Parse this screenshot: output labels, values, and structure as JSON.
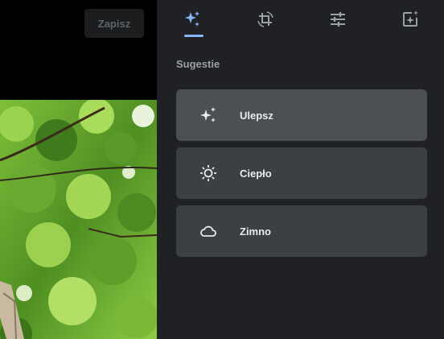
{
  "toolbar": {
    "save_label": "Zapisz"
  },
  "tabs": [
    {
      "name": "suggestions-tab",
      "icon": "sparkle-icon",
      "active": true
    },
    {
      "name": "crop-rotate-tab",
      "icon": "crop-rotate-icon",
      "active": false
    },
    {
      "name": "adjust-tab",
      "icon": "sliders-icon",
      "active": false
    },
    {
      "name": "filters-tab",
      "icon": "image-sparkle-icon",
      "active": false
    }
  ],
  "suggestions": {
    "title": "Sugestie",
    "items": [
      {
        "label": "Ulepsz",
        "icon": "sparkle-icon"
      },
      {
        "label": "Ciepło",
        "icon": "sun-icon"
      },
      {
        "label": "Zimno",
        "icon": "cloud-icon"
      }
    ]
  },
  "colors": {
    "panel_bg": "#202124",
    "card_bg": "#3c4043",
    "card_active_bg": "#4c4f53",
    "accent": "#8ab4f8",
    "text": "#e8eaed",
    "muted_text": "#9aa0a6"
  }
}
